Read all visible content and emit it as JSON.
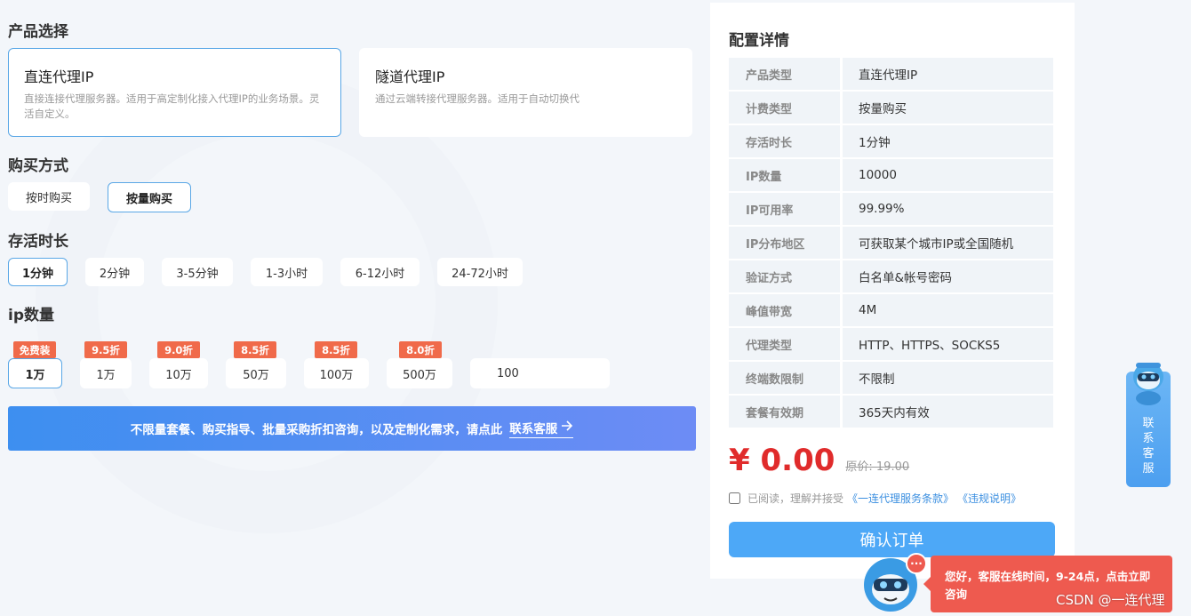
{
  "sections": {
    "product": "产品选择",
    "purchase": "购买方式",
    "duration": "存活时长",
    "quantity": "ip数量"
  },
  "products": [
    {
      "title": "直连代理IP",
      "desc": "直接连接代理服务器。适用于高定制化接入代理IP的业务场景。灵活自定义。",
      "selected": true
    },
    {
      "title": "隧道代理IP",
      "desc": "通过云端转接代理服务器。适用于自动切换代",
      "selected": false
    }
  ],
  "purchase_methods": [
    "按时购买",
    "按量购买"
  ],
  "durations": [
    "1分钟",
    "2分钟",
    "3-5分钟",
    "1-3小时",
    "6-12小时",
    "24-72小时"
  ],
  "quantities": [
    {
      "badge": "免费装",
      "label": "1万"
    },
    {
      "badge": "9.5折",
      "label": "1万"
    },
    {
      "badge": "9.0折",
      "label": "10万"
    },
    {
      "badge": "8.5折",
      "label": "50万"
    },
    {
      "badge": "8.5折",
      "label": "100万"
    },
    {
      "badge": "8.0折",
      "label": "500万"
    }
  ],
  "custom_quantity": "100",
  "banner": {
    "text": "不限量套餐、购买指导、批量采购折扣咨询，以及定制化需求，请点此",
    "link": "联系客服"
  },
  "config": {
    "title": "配置详情",
    "rows": [
      {
        "k": "产品类型",
        "v": "直连代理IP"
      },
      {
        "k": "计费类型",
        "v": "按量购买"
      },
      {
        "k": "存活时长",
        "v": "1分钟"
      },
      {
        "k": "IP数量",
        "v": "10000"
      },
      {
        "k": "IP可用率",
        "v": "99.99%"
      },
      {
        "k": "IP分布地区",
        "v": "可获取某个城市IP或全国随机"
      },
      {
        "k": "验证方式",
        "v": "白名单&帐号密码"
      },
      {
        "k": "峰值带宽",
        "v": "4M"
      },
      {
        "k": "代理类型",
        "v": "HTTP、HTTPS、SOCKS5"
      },
      {
        "k": "终端数限制",
        "v": "不限制"
      },
      {
        "k": "套餐有效期",
        "v": "365天内有效"
      }
    ],
    "price": "¥ 0.00",
    "original_price": "原价: 19.00",
    "agree_text": "已阅读，理解并接受",
    "terms_link": "《一连代理服务条款》",
    "rules_link": "《违规说明》",
    "confirm": "确认订单"
  },
  "side_widget": {
    "c1": "联",
    "c2": "系",
    "c3": "客",
    "c4": "服"
  },
  "chat": {
    "message": "您好，客服在线时间，9-24点，点击立即咨询",
    "dots": "···"
  },
  "watermark": "CSDN @一连代理",
  "colors": {
    "accent": "#4da8f7",
    "badge": "#f06a4a",
    "price": "#e02b2b",
    "chat": "#ee5a4f"
  }
}
